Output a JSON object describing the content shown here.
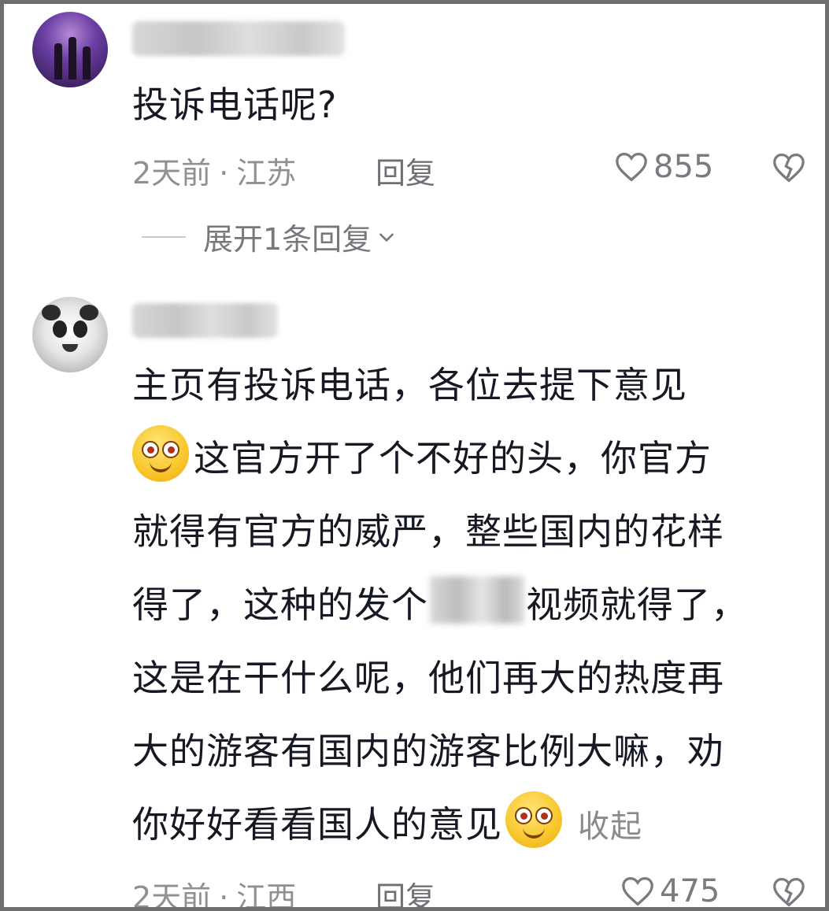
{
  "comments": [
    {
      "text": "投诉电话呢?",
      "meta": {
        "time": "2天前",
        "separator": "·",
        "location": "江苏",
        "reply": "回复"
      },
      "likes": "855",
      "expand_replies": "展开1条回复"
    },
    {
      "lines": [
        {
          "pre": "主页有投诉电话，各位去提下意见"
        },
        {
          "pre": "这官方开了个不好的头，你官方"
        },
        {
          "pre": "就得有官方的威严，整些国内的花样"
        },
        {
          "pre": "得了，这种的发个",
          "post": "视频就得了，"
        },
        {
          "pre": "这是在干什么呢，他们再大的热度再"
        },
        {
          "pre": "大的游客有国内的游客比例大嘛，劝"
        },
        {
          "pre": "你好好看看国人的意见"
        }
      ],
      "collapse": "收起",
      "meta": {
        "time": "2天前",
        "separator": "·",
        "location": "江西",
        "reply": "回复"
      },
      "likes": "475"
    }
  ],
  "icons": {
    "like": "heart-outline-icon",
    "dislike": "broken-heart-icon",
    "chevron": "chevron-down-icon",
    "emoji": "smiling-face-emoji"
  },
  "colors": {
    "text": "#161823",
    "meta": "#8f8f94",
    "frame": "#6e6e6e"
  }
}
